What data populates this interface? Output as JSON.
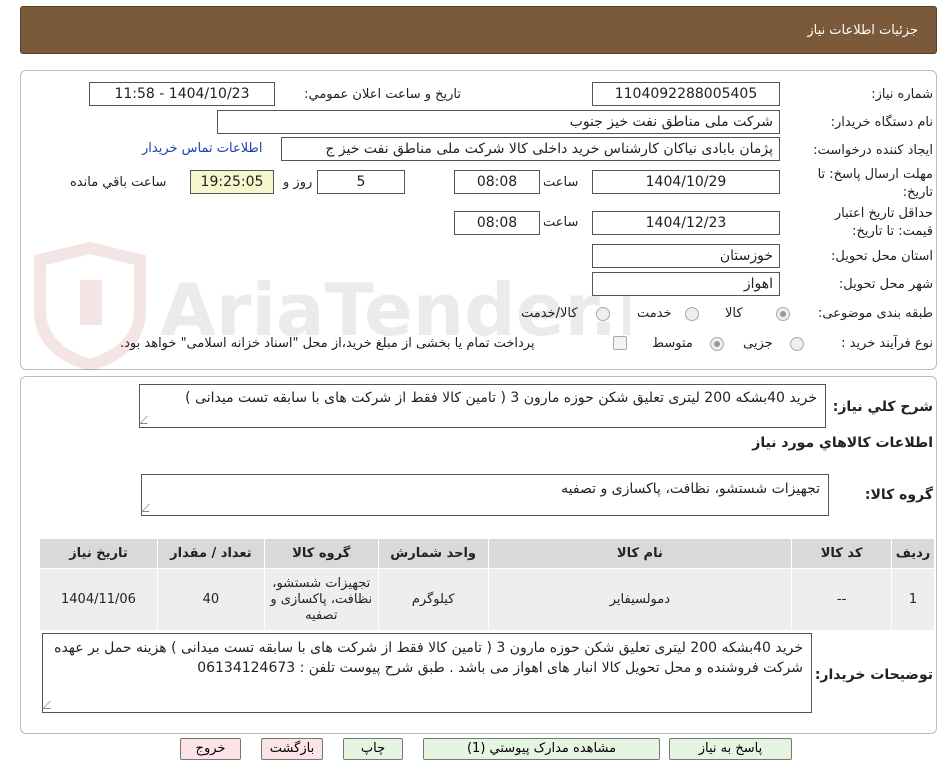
{
  "header": {
    "title": "جزئیات اطلاعات نیاز"
  },
  "need": {
    "number_label": "شماره نیاز:",
    "number": "1104092288005405",
    "announce_label": "تاریخ و ساعت اعلان عمومي:",
    "announce_value": "1404/10/23 - 11:58",
    "buyer_label": "نام دستگاه خریدار:",
    "buyer_value": "شرکت ملی مناطق نفت خیز جنوب",
    "creator_label": "ایجاد کننده درخواست:",
    "creator_value": "پژمان  بابادی نیاکان  کارشناس خرید داخلی کالا  شرکت ملی مناطق نفت خیز ج",
    "contact_link": "اطلاعات تماس خریدار",
    "deadline_label_1": "مهلت ارسال پاسخ: تا",
    "deadline_label_2": "تاریخ:",
    "deadline_date": "1404/10/29",
    "time_label": "ساعت",
    "deadline_time": "08:08",
    "days_value": "5",
    "days_label": "روز و",
    "remaining_value": "19:25:05",
    "remaining_label": "ساعت باقي مانده",
    "validity_label_1": "حداقل تاریخ اعتبار",
    "validity_label_2": "قیمت: تا تاریخ:",
    "validity_date": "1404/12/23",
    "validity_time": "08:08",
    "province_label": "استان محل تحویل:",
    "province_value": "خوزستان",
    "city_label": "شهر محل تحویل:",
    "city_value": "اهواز",
    "category_label": "طبقه بندی موضوعی:",
    "category_options": [
      "کالا",
      "خدمت",
      "کالا/خدمت"
    ],
    "process_label": "نوع فرآیند خرید :",
    "process_options": [
      "جزیی",
      "متوسط"
    ],
    "payment_note": "پرداخت تمام یا بخشی از مبلغ خرید،از محل \"اسناد خزانه اسلامی\" خواهد بود."
  },
  "summary": {
    "label": "شرح کلي نياز:",
    "value": "خرید 40بشکه 200 لیتری تعلیق شکن حوزه مارون 3 ( تامین کالا فقط از شرکت های با سابقه تست میدانی )"
  },
  "goods": {
    "section_title": "اطلاعات کالاهاي مورد نياز",
    "group_label": "گروه کالا:",
    "group_value": "تجهیزات شستشو، نظافت، پاکسازی و تصفیه",
    "columns": [
      "رديف",
      "کد کالا",
      "نام کالا",
      "واحد شمارش",
      "گروه کالا",
      "تعداد / مقدار",
      "تاریخ نیاز"
    ],
    "rows": [
      {
        "row": "1",
        "code": "--",
        "name": "دمولسیفایر",
        "unit": "کیلوگرم",
        "group": "تجهیزات شستشو، نظافت، پاکسازی و تصفیه",
        "qty": "40",
        "date": "1404/11/06"
      }
    ]
  },
  "buyer_notes": {
    "label": "توضیحات خریدار:",
    "value": "خرید 40بشکه 200 لیتری تعلیق شکن حوزه مارون 3 ( تامین کالا فقط از شرکت های با سابقه تست میدانی ) هزینه حمل بر عهده شرکت فروشنده و محل تحویل کالا انبار های  اهواز می باشد . طبق شرح پیوست  تلفن : 06134124673"
  },
  "buttons": {
    "reply": "پاسخ به نیاز",
    "attachments": "مشاهده مدارک پیوستي (1)",
    "print": "چاپ",
    "back": "بازگشت",
    "exit": "خروج"
  },
  "watermark": {
    "text": "AriaTender.neT"
  }
}
